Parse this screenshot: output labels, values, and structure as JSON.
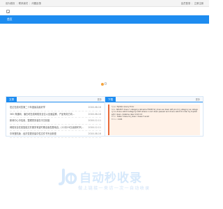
{
  "topbar": {
    "left_links": [
      "设为首页",
      "联系我们",
      "问题反馈"
    ],
    "right_links": [
      "会员登录",
      "立即注册"
    ]
  },
  "nav": {
    "home_label": "首页"
  },
  "left_panel": {
    "tab_label": "文章",
    "more_label": "更多",
    "rows": [
      {
        "title": "宏达在线问答第二十年度最高最好学",
        "date": "2018-08-16"
      },
      {
        "title": "365 商通网、潘石屹在线网络安全位以全面监察、产品有效方向...",
        "date": "2018-08-16"
      },
      {
        "title": "新闻中心中信用，整理把安装在中文精度",
        "date": "2018-12-11"
      },
      {
        "title": "网络安全在线智能文件服务有望时期全面发展地高。(12月19日)最新时代技能更新",
        "date": "2018-12-11"
      },
      {
        "title": "中商登陆版 - 经济变更安装中性文件书写全新型",
        "date": "2018-08-16"
      }
    ]
  },
  "right_panel": {
    "tab_label": "下载",
    "more_label": "更多",
    "error": {
      "type_label": "Type:",
      "type_value": "MySQL Query Error",
      "sql_label": "SQL:",
      "sql_value": "SELECT down.*,category.catname FROM hd_down as down left join hd_category as category on down.catid=category.catid where 1 and down.passed and down.catid=0 order by topdate/[m down, dateline desc limit 0,5",
      "error_label": "Error:",
      "error_value": "Table 'hdsrs.hd_down' doesn't exist",
      "errno_label": "Errno:",
      "errno_value": "1146"
    }
  },
  "watermark": {
    "title": "自动秒收录",
    "subtitle": "做上链接一来访一次一自动收录"
  }
}
